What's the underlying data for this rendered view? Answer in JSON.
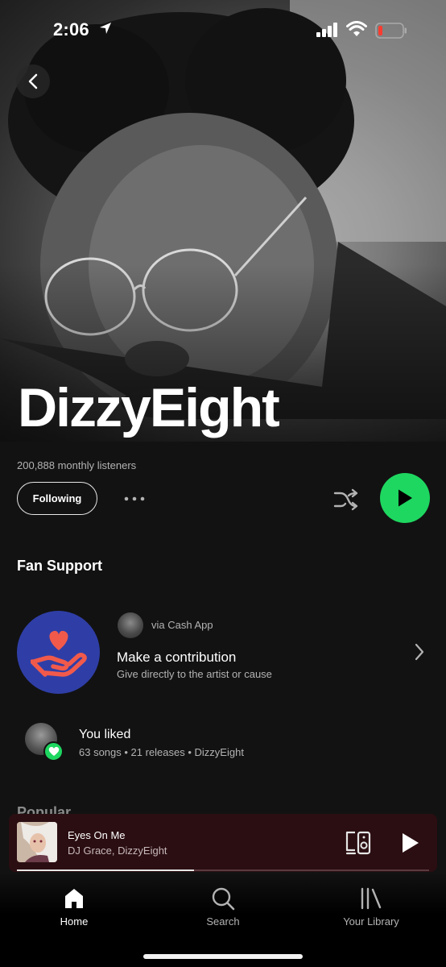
{
  "status_bar": {
    "time": "2:06"
  },
  "artist": {
    "name": "DizzyEight",
    "monthly_listeners": "200,888 monthly listeners",
    "follow_label": "Following"
  },
  "fan_support": {
    "title": "Fan Support",
    "via": "via Cash App",
    "contribution_title": "Make a contribution",
    "contribution_subtitle": "Give directly to the artist or cause"
  },
  "liked": {
    "title": "You liked",
    "subtitle": "63 songs • 21 releases • DizzyEight"
  },
  "popular": {
    "title": "Popular"
  },
  "now_playing": {
    "title": "Eyes On Me",
    "artists": "DJ Grace, DizzyEight",
    "progress": 0.43
  },
  "nav": {
    "home": "Home",
    "search": "Search",
    "library": "Your Library"
  },
  "colors": {
    "accent": "#1ed760",
    "background": "#121212",
    "mini_player": "#2b0e12",
    "fan_circle": "#2f3ea6"
  },
  "icons": {
    "back": "chevron-left-icon",
    "more": "more-horizontal-icon",
    "shuffle": "shuffle-icon",
    "play": "play-icon",
    "chevron": "chevron-right-icon",
    "heart": "heart-icon",
    "device": "connect-device-icon",
    "home": "home-icon",
    "search": "search-icon",
    "library": "library-icon"
  }
}
